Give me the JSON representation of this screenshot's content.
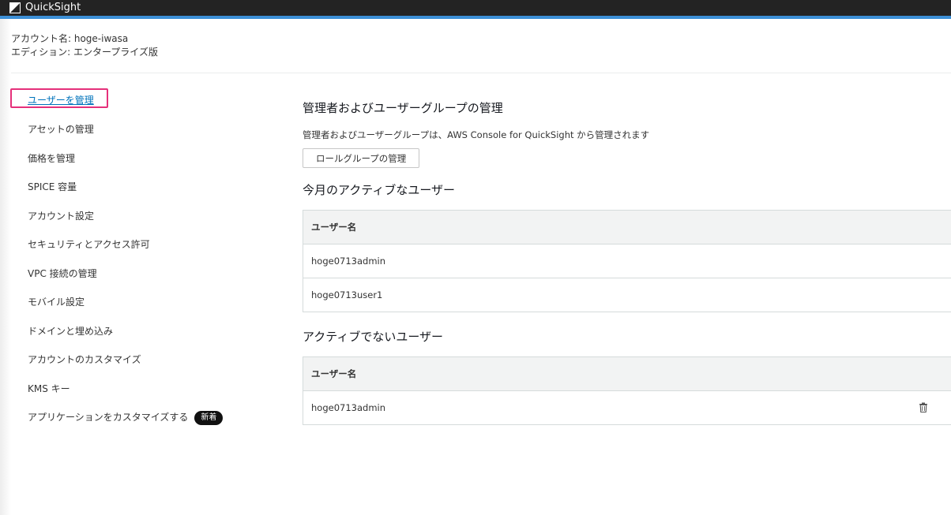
{
  "app": {
    "name": "QuickSight",
    "accent_color": "#3c8fd6",
    "topbar_color": "#232323"
  },
  "account": {
    "name_line": "アカウント名: hoge-iwasa",
    "edition_line": "エディション: エンタープライズ版"
  },
  "sidebar": {
    "items": [
      {
        "label": "ユーザーを管理",
        "active": true
      },
      {
        "label": "アセットの管理"
      },
      {
        "label": "価格を管理"
      },
      {
        "label": "SPICE 容量"
      },
      {
        "label": "アカウント設定"
      },
      {
        "label": "セキュリティとアクセス許可"
      },
      {
        "label": "VPC 接続の管理"
      },
      {
        "label": "モバイル設定"
      },
      {
        "label": "ドメインと埋め込み"
      },
      {
        "label": "アカウントのカスタマイズ"
      },
      {
        "label": "KMS キー"
      },
      {
        "label": "アプリケーションをカスタマイズする",
        "badge": "新着"
      }
    ],
    "highlight_color": "#e5307a"
  },
  "main": {
    "admin_section": {
      "title": "管理者およびユーザーグループの管理",
      "description": "管理者およびユーザーグループは、AWS Console for QuickSight から管理されます",
      "button_label": "ロールグループの管理"
    },
    "active_users": {
      "title": "今月のアクティブなユーザー",
      "column_header": "ユーザー名",
      "rows": [
        "hoge0713admin",
        "hoge0713user1"
      ]
    },
    "inactive_users": {
      "title": "アクティブでないユーザー",
      "column_header": "ユーザー名",
      "rows": [
        "hoge0713admin"
      ],
      "row_action_icon": "trash-icon"
    }
  }
}
